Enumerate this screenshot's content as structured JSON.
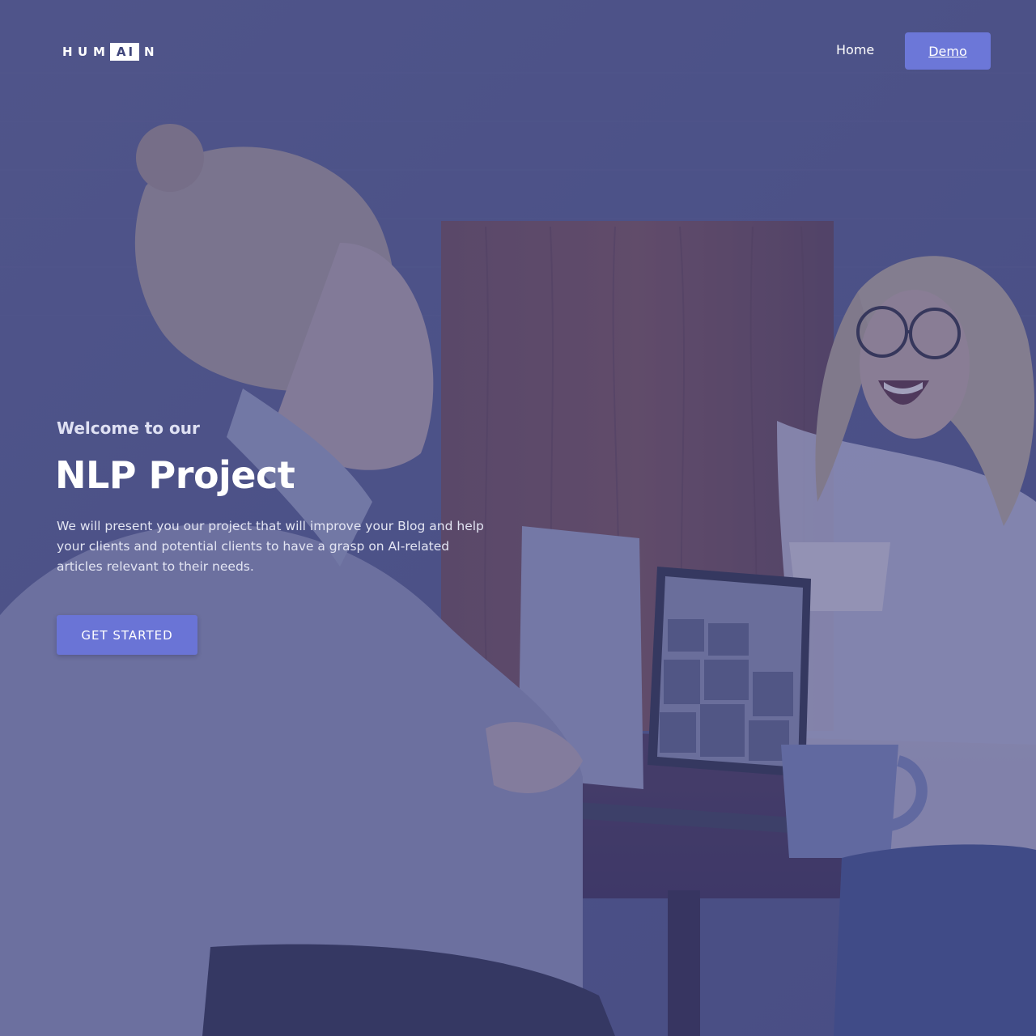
{
  "brand": {
    "logo_prefix": [
      "H",
      "U",
      "M"
    ],
    "logo_boxed": "AI",
    "logo_suffix": "N"
  },
  "nav": {
    "home_label": "Home",
    "demo_label": "Demo"
  },
  "hero": {
    "welcome": "Welcome to our",
    "title": "NLP Project",
    "description": "We will present you our project that will improve your Blog and help your clients and potential clients to have a grasp on AI-related articles relevant to their needs.",
    "cta_label": "GET STARTED"
  },
  "colors": {
    "overlay": "#424882",
    "accent_button": "#6c77d8",
    "text_primary": "#ffffff",
    "text_muted": "#dfe1f3"
  }
}
